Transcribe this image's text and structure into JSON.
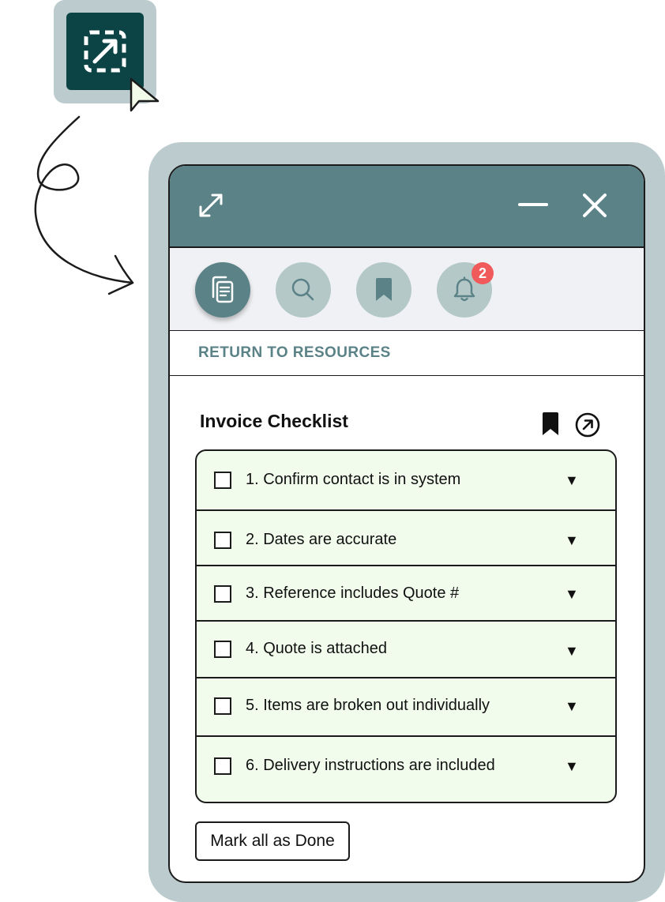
{
  "launcher": {
    "icon": "expand-dashed-square-icon"
  },
  "cursor": {
    "icon": "mouse-pointer-icon"
  },
  "colors": {
    "titlebar": "#5a8287",
    "halo": "#bccbcd",
    "launcher_bg": "#0c4446",
    "tool_inactive": "#b4c8c8",
    "checklist_bg": "#f1fced",
    "badge": "#f05a5a",
    "link": "#5a8287"
  },
  "window": {
    "expand_icon": "resize-diagonal-icon",
    "minimize_icon": "minimize-icon",
    "close_icon": "close-icon"
  },
  "toolbar": {
    "items": [
      {
        "name": "documents",
        "icon": "documents-icon",
        "active": true
      },
      {
        "name": "search",
        "icon": "search-icon",
        "active": false
      },
      {
        "name": "bookmarks",
        "icon": "bookmark-icon",
        "active": false
      },
      {
        "name": "notifications",
        "icon": "bell-icon",
        "active": false,
        "badge": "2"
      }
    ]
  },
  "nav": {
    "return_label": "RETURN TO RESOURCES"
  },
  "section": {
    "title": "Invoice Checklist",
    "bookmark_icon": "bookmark-icon",
    "open_icon": "open-external-icon"
  },
  "checklist": {
    "items": [
      {
        "label": "1. Confirm contact is in system",
        "checked": false
      },
      {
        "label": "2. Dates are accurate",
        "checked": false
      },
      {
        "label": "3. Reference includes Quote #",
        "checked": false
      },
      {
        "label": "4. Quote is attached",
        "checked": false
      },
      {
        "label": "5. Items are broken out individually",
        "checked": false
      },
      {
        "label": "6. Delivery instructions are included",
        "checked": false
      }
    ],
    "expand_glyph": "▼"
  },
  "actions": {
    "mark_all_label": "Mark all as Done"
  }
}
